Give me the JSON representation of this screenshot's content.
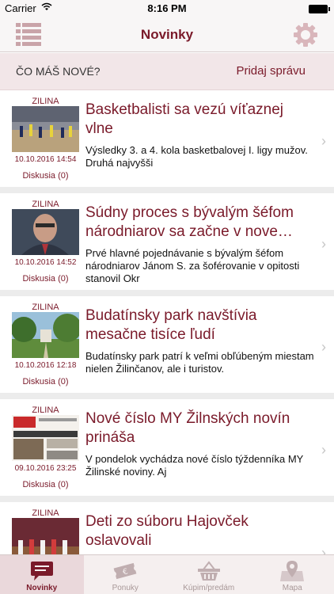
{
  "status_bar": {
    "carrier": "Carrier",
    "time": "8:16 PM"
  },
  "navbar": {
    "title": "Novinky",
    "menu_icon": "list-menu-icon",
    "settings_icon": "gear-icon"
  },
  "post_bar": {
    "prompt": "ČO MÁŠ NOVÉ?",
    "add_label": "Pridaj správu"
  },
  "articles": [
    {
      "city": "ZILINA",
      "date": "10.10.2016 14:54",
      "discussion": "Diskusia (0)",
      "headline": "Basketbalisti sa vezú víťaznej vlne",
      "excerpt": "Výsledky 3. a 4. kola basketbalovej I. ligy mužov.                 Druhá najvyšši"
    },
    {
      "city": "ZILINA",
      "date": "10.10.2016 14:52",
      "discussion": "Diskusia (0)",
      "headline": "Súdny proces s bývalým šéfom národniarov sa začne v nove…",
      "excerpt": "Prvé hlavné pojednávanie s bývalým šéfom národniarov Jánom S. za šoférovanie v opitosti stanovil Okr"
    },
    {
      "city": "ZILINA",
      "date": "10.10.2016 12:18",
      "discussion": "Diskusia (0)",
      "headline": "Budatínsky park navštívia mesačne tisíce ľudí",
      "excerpt": "Budatínsky park patrí k veľmi obľúbeným miestam nielen Žilinčanov, ale i turistov."
    },
    {
      "city": "ZILINA",
      "date": "09.10.2016 23:25",
      "discussion": "Diskusia (0)",
      "headline": "Nové číslo MY Žilnských novín prináša",
      "excerpt": "V pondelok vychádza nové číslo týždenníka MY Žilinské noviny.                 Aj"
    },
    {
      "city": "ZILINA",
      "date": "",
      "discussion": "",
      "headline": "Deti zo súboru Hajovček oslavovali",
      "excerpt": ""
    }
  ],
  "tabs": [
    {
      "label": "Novinky",
      "icon": "news-icon",
      "active": true
    },
    {
      "label": "Ponuky",
      "icon": "ticket-icon",
      "active": false
    },
    {
      "label": "Kúpim/predám",
      "icon": "basket-icon",
      "active": false
    },
    {
      "label": "Mapa",
      "icon": "map-pin-icon",
      "active": false
    }
  ],
  "colors": {
    "accent": "#7a1a2a",
    "post_bar_bg": "#f2e6e8",
    "feed_gap": "#ececec",
    "tab_inactive": "#a89898"
  }
}
